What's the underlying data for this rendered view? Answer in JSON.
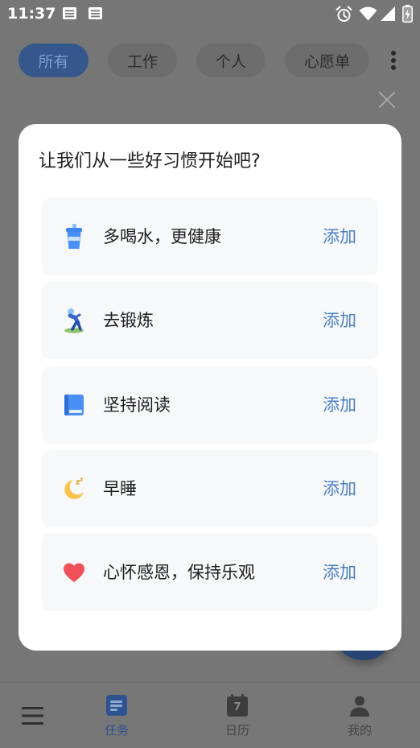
{
  "status_bar": {
    "time": "11:37",
    "notification_icons": [
      "notes-icon",
      "notes-icon"
    ],
    "system_icons": [
      "alarm-icon",
      "wifi-icon",
      "signal-icon",
      "battery-charging-icon"
    ]
  },
  "tabs": [
    {
      "label": "所有",
      "selected": true
    },
    {
      "label": "工作",
      "selected": false
    },
    {
      "label": "个人",
      "selected": false
    },
    {
      "label": "心愿单",
      "selected": false
    }
  ],
  "toolbar": {
    "more_icon": "more-vert-icon"
  },
  "dialog": {
    "title": "让我们从一些好习惯开始吧?",
    "close_icon": "close-icon",
    "habits": [
      {
        "icon": "water-cup-icon",
        "label": "多喝水，更健康",
        "action": "添加"
      },
      {
        "icon": "exercise-icon",
        "label": "去锻炼",
        "action": "添加"
      },
      {
        "icon": "book-icon",
        "label": "坚持阅读",
        "action": "添加"
      },
      {
        "icon": "moon-sleep-icon",
        "label": "早睡",
        "action": "添加"
      },
      {
        "icon": "heart-icon",
        "label": "心怀感恩，保持乐观",
        "action": "添加"
      }
    ]
  },
  "bottom_nav": {
    "menu_icon": "menu-icon",
    "items": [
      {
        "label": "任务",
        "icon": "task-list-icon",
        "selected": true
      },
      {
        "label": "日历",
        "icon": "calendar-icon",
        "calendar_day": "7",
        "selected": false
      },
      {
        "label": "我的",
        "icon": "person-icon",
        "selected": false
      }
    ]
  },
  "colors": {
    "accent": "#4a7fc4",
    "dialog_background": "#ffffff",
    "card_background": "#f7f8fa",
    "scrim_background": "#767676",
    "heart": "#f0505a",
    "moon": "#fcc14a"
  }
}
